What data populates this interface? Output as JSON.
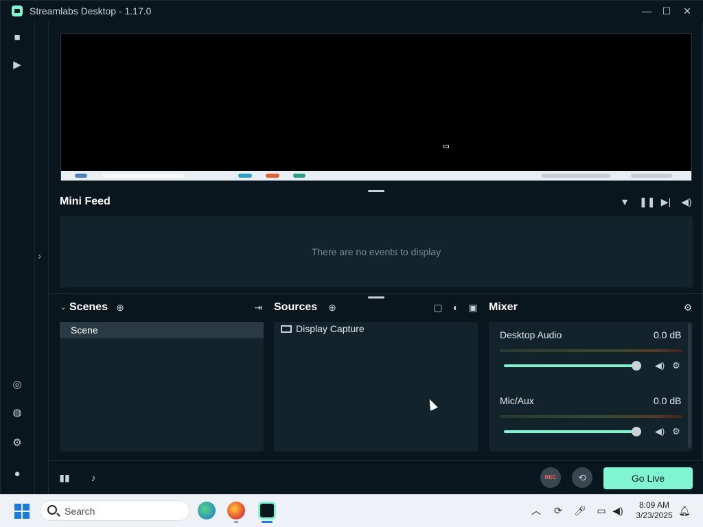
{
  "window": {
    "title": "Streamlabs Desktop - 1.17.0",
    "minimize": "—",
    "maximize": "☐",
    "close": "✕"
  },
  "mini_feed": {
    "title": "Mini Feed",
    "empty_text": "There are no events to display"
  },
  "scenes": {
    "title": "Scenes",
    "items": [
      "Scene"
    ]
  },
  "sources": {
    "title": "Sources",
    "items": [
      "Display Capture"
    ]
  },
  "mixer": {
    "title": "Mixer",
    "channels": [
      {
        "name": "Desktop Audio",
        "db": "0.0 dB",
        "level": 1.0
      },
      {
        "name": "Mic/Aux",
        "db": "0.0 dB",
        "level": 1.0
      }
    ]
  },
  "footer": {
    "rec_label": "REC",
    "go_live_label": "Go Live"
  },
  "taskbar": {
    "search_placeholder": "Search",
    "time": "8:09 AM",
    "date": "3/23/2025"
  },
  "colors": {
    "accent": "#80f5d2",
    "background": "#09161d",
    "panel": "#13232c"
  },
  "icons": {
    "nav": [
      "studio-icon",
      "play-icon",
      "themes-icon",
      "apps-icon",
      "settings-icon",
      "profile-icon"
    ],
    "feed_tools": [
      "filter-icon",
      "pause-icon",
      "skip-icon",
      "volume-icon"
    ]
  }
}
